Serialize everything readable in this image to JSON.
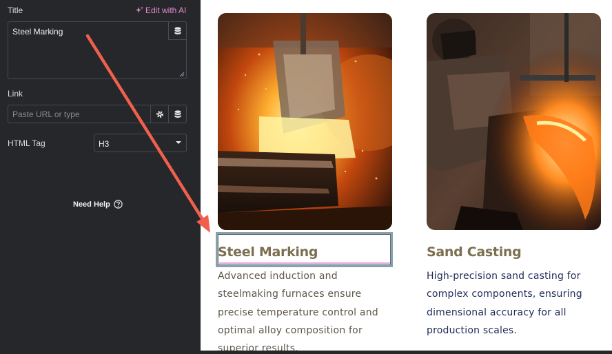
{
  "panel": {
    "title_label": "Title",
    "edit_ai_label": "Edit with AI",
    "title_value": "Steel Marking",
    "link_label": "Link",
    "link_placeholder": "Paste URL or type",
    "html_tag_label": "HTML Tag",
    "html_tag_value": "H3",
    "need_help_label": "Need Help"
  },
  "cards": [
    {
      "title": "Steel Marking",
      "description": "Advanced induction and steelmaking furnaces ensure precise temperature control and optimal alloy composition for superior results."
    },
    {
      "title": "Sand Casting",
      "description": "High-precision sand casting for complex components, ensuring dimensional accuracy for all production scales."
    }
  ],
  "colors": {
    "panel_bg": "#26272b",
    "ai_accent": "#e58ad0",
    "heading": "#7c6e50",
    "arrow": "#f0604d"
  }
}
